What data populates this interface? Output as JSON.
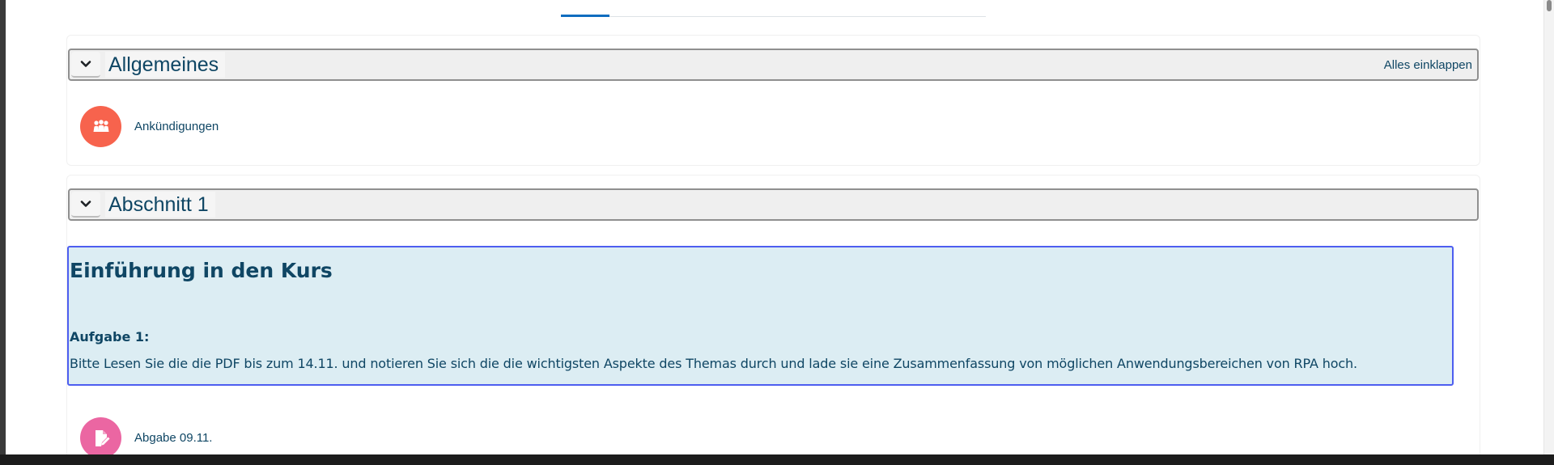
{
  "sections": {
    "general": {
      "title": "Allgemeines",
      "collapse_all": "Alles einklappen",
      "activity": {
        "label": "Ankündigungen",
        "icon": "forum-icon",
        "icon_color": "#f7634d"
      }
    },
    "section1": {
      "title": "Abschnitt 1",
      "intro": {
        "heading": "Einführung in den Kurs",
        "task_label": "Aufgabe 1:",
        "task_text": "Bitte Lesen Sie die die PDF bis zum 14.11. und notieren Sie sich die die wichtigsten Aspekte des Themas durch und lade sie eine Zusammenfassung von möglichen Anwendungsbereichen von RPA hoch."
      },
      "activity": {
        "label": "Abgabe 09.11.",
        "icon": "assignment-icon",
        "icon_color": "#eb66a2"
      }
    }
  },
  "colors": {
    "link": "#0f4664",
    "active_tab": "#0f6cbf",
    "intro_background": "#dcedf3",
    "intro_border": "#4d5ef0"
  }
}
